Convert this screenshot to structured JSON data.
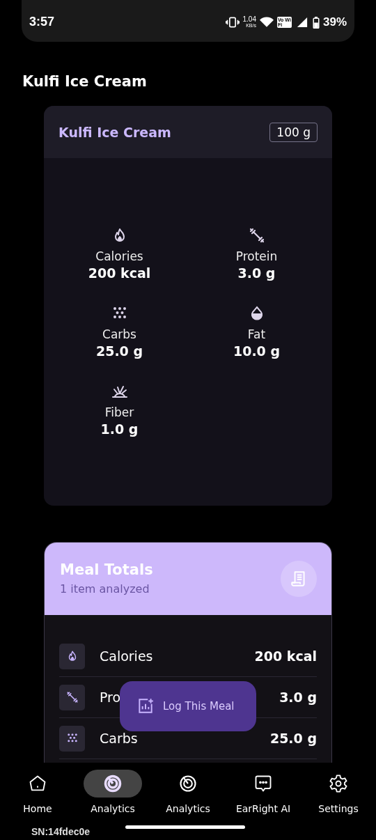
{
  "status_bar": {
    "time": "3:57",
    "net_speed": "1.04",
    "net_unit": "KB/s",
    "wifi_calling": "Vo WiFi",
    "battery": "39%"
  },
  "page_title": "Kulfi Ice Cream",
  "food_card": {
    "name": "Kulfi Ice Cream",
    "portion": "100 g",
    "nutrients": [
      {
        "kind": "calories",
        "label": "Calories",
        "value": "200 kcal"
      },
      {
        "kind": "protein",
        "label": "Protein",
        "value": "3.0 g"
      },
      {
        "kind": "carbs",
        "label": "Carbs",
        "value": "25.0 g"
      },
      {
        "kind": "fat",
        "label": "Fat",
        "value": "10.0 g"
      },
      {
        "kind": "fiber",
        "label": "Fiber",
        "value": "1.0 g"
      }
    ]
  },
  "meal_totals": {
    "title": "Meal Totals",
    "subtitle": "1 item analyzed",
    "rows": [
      {
        "kind": "calories",
        "label": "Calories",
        "value": "200 kcal"
      },
      {
        "kind": "protein",
        "label": "Pro",
        "value": "3.0 g"
      },
      {
        "kind": "carbs",
        "label": "Carbs",
        "value": "25.0 g"
      }
    ]
  },
  "log_button": "Log This Meal",
  "nav": [
    {
      "kind": "home",
      "label": "Home",
      "selected": false
    },
    {
      "kind": "analytics",
      "label": "Analytics",
      "selected": true
    },
    {
      "kind": "analytics",
      "label": "Analytics",
      "selected": false
    },
    {
      "kind": "chat",
      "label": "EarRight AI",
      "selected": false
    },
    {
      "kind": "settings",
      "label": "Settings",
      "selected": false
    }
  ],
  "serial": "SN:14fdec0e"
}
